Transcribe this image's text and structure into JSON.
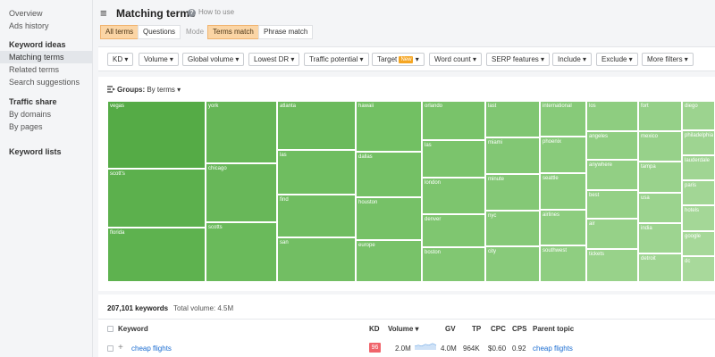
{
  "sidebar": {
    "items_top": [
      "Overview",
      "Ads history"
    ],
    "section1_title": "Keyword ideas",
    "section1_items": [
      "Matching terms",
      "Related terms",
      "Search suggestions"
    ],
    "section2_title": "Traffic share",
    "section2_items": [
      "By domains",
      "By pages"
    ],
    "section3_title": "Keyword lists"
  },
  "header": {
    "title": "Matching terms",
    "help": "How to use"
  },
  "tabs": {
    "all_terms": "All terms",
    "questions": "Questions",
    "mode": "Mode",
    "terms_match": "Terms match",
    "phrase_match": "Phrase match"
  },
  "filters": {
    "kd": "KD ▾",
    "volume": "Volume ▾",
    "global_volume": "Global volume ▾",
    "lowest_dr": "Lowest DR ▾",
    "traffic_potential": "Traffic potential ▾",
    "target": "Target",
    "target_badge": "New",
    "target_caret": "▾",
    "word_count": "Word count ▾",
    "serp_features": "SERP features ▾",
    "include": "Include ▾",
    "exclude": "Exclude ▾",
    "more_filters": "More filters ▾"
  },
  "groups": {
    "label": "Groups:",
    "value": "By terms ▾",
    "icon": "groups-icon"
  },
  "treemap": {
    "cells": [
      "vegas",
      "scott's",
      "florida",
      "york",
      "chicago",
      "scotts",
      "atlanta",
      "las",
      "find",
      "san",
      "hawaii",
      "dallas",
      "houston",
      "europe",
      "orlando",
      "las",
      "london",
      "denver",
      "boston",
      "last",
      "miami",
      "minute",
      "nyc",
      "city",
      "international",
      "phoenix",
      "seattle",
      "airlines",
      "southwest",
      "los",
      "angeles",
      "anywhere",
      "best",
      "air",
      "tickets",
      "fort",
      "mexico",
      "tampa",
      "usa",
      "india",
      "detroit",
      "diego",
      "philadelphia",
      "lauderdale",
      "paris",
      "hotels",
      "google",
      "dc"
    ]
  },
  "table": {
    "count": "207,101 keywords",
    "total_volume": "Total volume: 4.5M",
    "headers": {
      "keyword": "Keyword",
      "kd": "KD",
      "volume": "Volume ▾",
      "gv": "GV",
      "tp": "TP",
      "cpc": "CPC",
      "cps": "CPS",
      "parent_topic": "Parent topic"
    },
    "rows": [
      {
        "keyword": "cheap flights",
        "kd": "96",
        "volume": "2.0M",
        "gv": "4.0M",
        "tp": "964K",
        "cpc": "$0.60",
        "cps": "0.92",
        "parent_topic": "cheap flights"
      }
    ]
  },
  "colors": {
    "accent_selected": "#fbd5a5",
    "kd_hard": "#f0646b",
    "link": "#1a6cd1"
  }
}
